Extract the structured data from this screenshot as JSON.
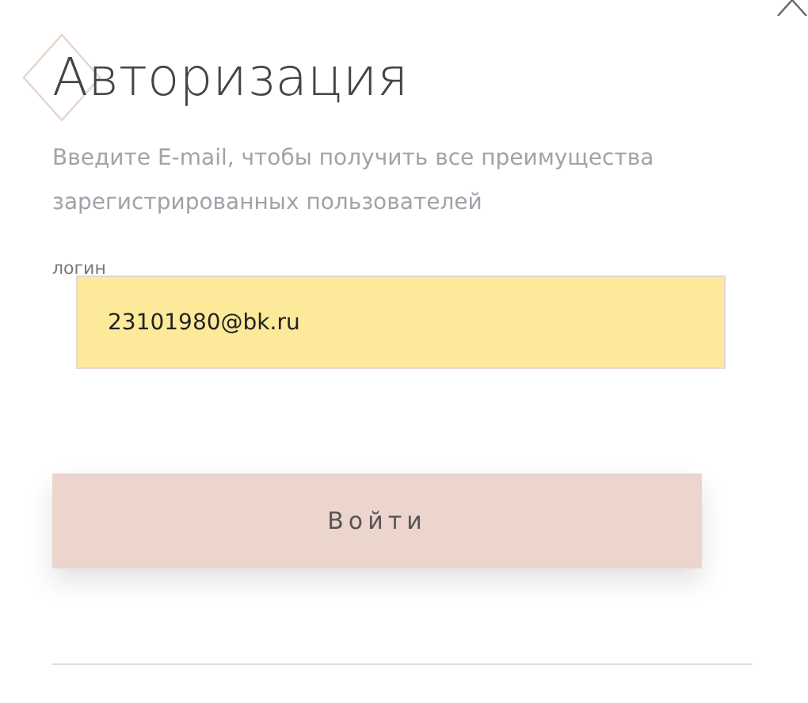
{
  "title": "Авторизация",
  "description": "Введите E-mail, чтобы получить все преимущества зарегистрированных пользователей",
  "login_field": {
    "label": "логин",
    "value": "23101980@bk.ru"
  },
  "submit_button": {
    "label": "Войти"
  }
}
